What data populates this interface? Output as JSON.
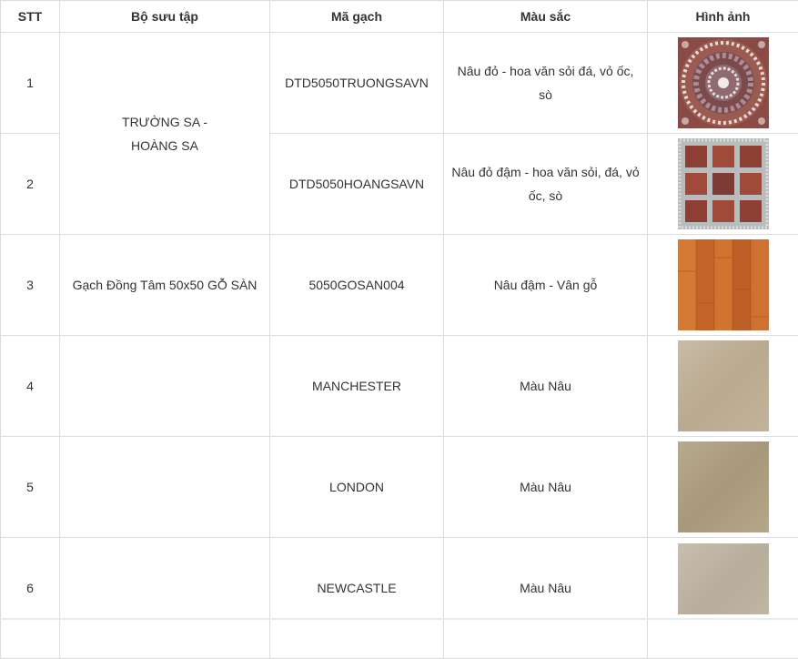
{
  "headers": {
    "stt": "STT",
    "collection": "Bộ sưu tập",
    "code": "Mã gạch",
    "color": "Màu sắc",
    "image": "Hình ảnh"
  },
  "rows": [
    {
      "stt": "1",
      "code": "DTD5050TRUONGSAVN",
      "color": "Nâu đỏ - hoa văn sỏi đá, vỏ ốc, sò",
      "image": "tile-truongsa-pebble-mosaic"
    },
    {
      "stt": "2",
      "code": "DTD5050HOANGSAVN",
      "color": "Nâu đỏ đậm - hoa văn sỏi, đá, vỏ ốc, sò",
      "image": "tile-hoangsa-pebble-grid"
    },
    {
      "stt": "3",
      "collection": "Gạch Đồng Tâm 50x50 GỖ SÀN",
      "code": "5050GOSAN004",
      "color": "Nâu đậm - Vân gỗ",
      "image": "tile-wood-plank"
    },
    {
      "stt": "4",
      "collection": "",
      "code": "MANCHESTER",
      "color": "Màu Nâu",
      "image": "tile-manchester-beige"
    },
    {
      "stt": "5",
      "collection": "",
      "code": "LONDON",
      "color": "Màu Nâu",
      "image": "tile-london-beige"
    },
    {
      "stt": "6",
      "collection": "",
      "code": "NEWCASTLE",
      "color": "Màu Nâu",
      "image": "tile-newcastle-beige"
    }
  ],
  "merged_collection": {
    "line1": "TRƯỜNG SA -",
    "line2": "HOÀNG SA"
  }
}
